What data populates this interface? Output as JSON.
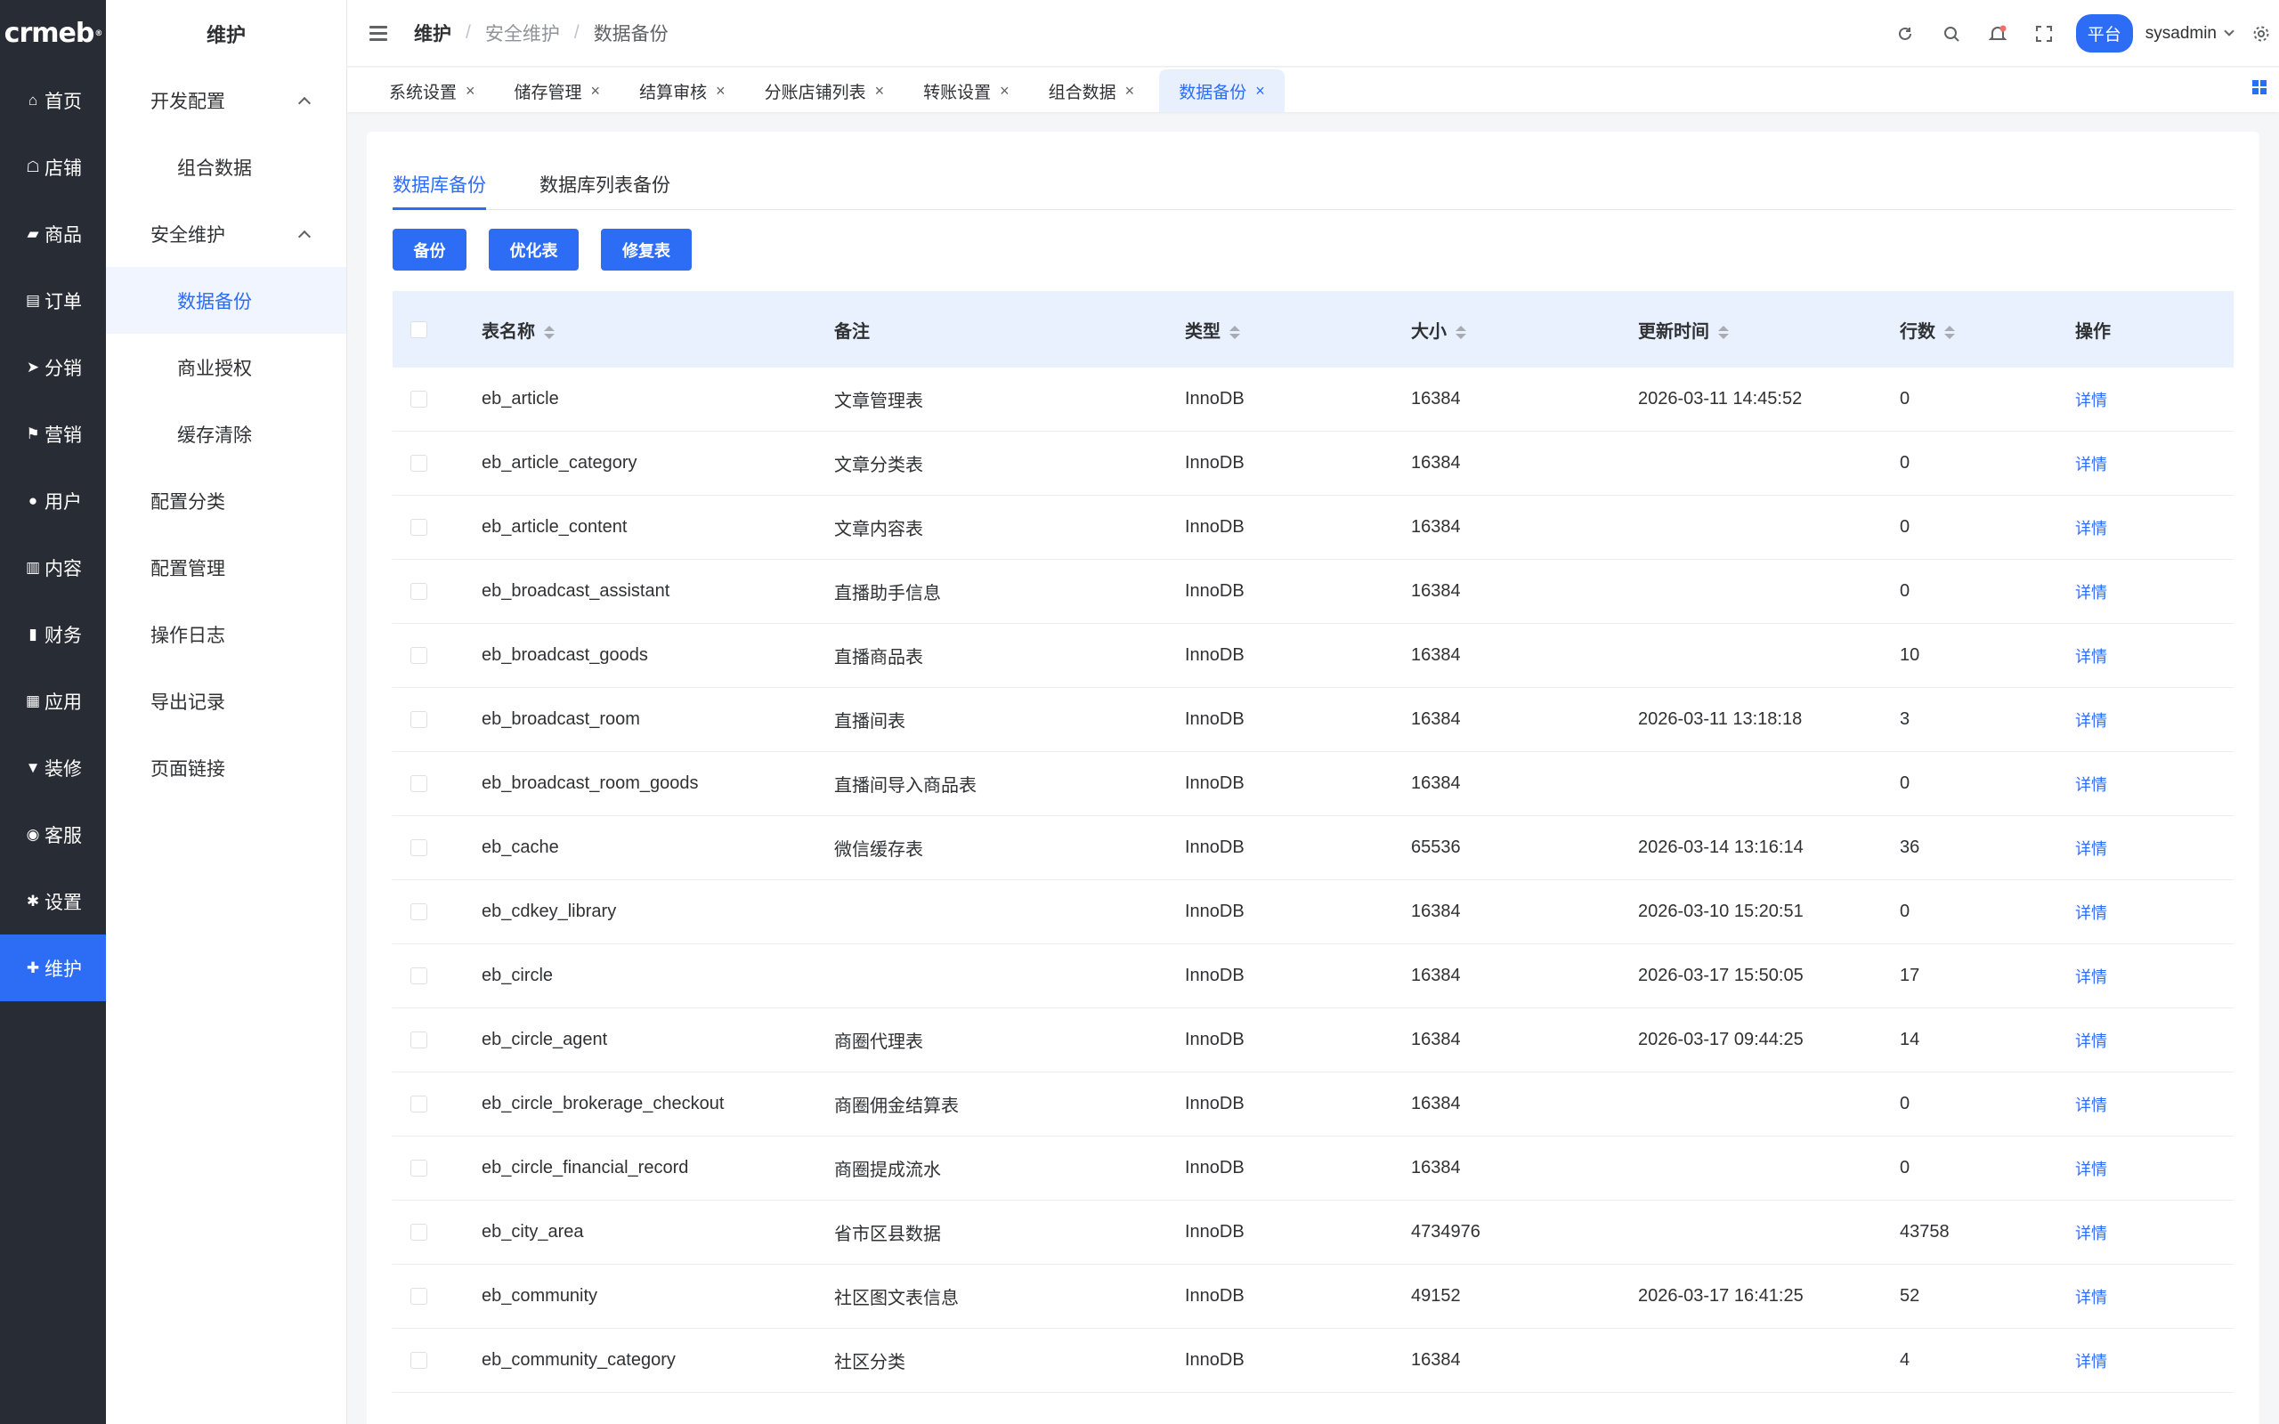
{
  "sidebar": {
    "logo": "crmeb",
    "items": [
      {
        "label": "首页",
        "icon": "home-icon"
      },
      {
        "label": "店铺",
        "icon": "store-icon"
      },
      {
        "label": "商品",
        "icon": "bag-icon"
      },
      {
        "label": "订单",
        "icon": "clipboard-icon"
      },
      {
        "label": "分销",
        "icon": "send-icon"
      },
      {
        "label": "营销",
        "icon": "flag-icon"
      },
      {
        "label": "用户",
        "icon": "user-icon"
      },
      {
        "label": "内容",
        "icon": "book-icon"
      },
      {
        "label": "财务",
        "icon": "bar-chart-icon"
      },
      {
        "label": "应用",
        "icon": "grid-icon"
      },
      {
        "label": "装修",
        "icon": "paint-icon"
      },
      {
        "label": "客服",
        "icon": "headset-icon"
      },
      {
        "label": "设置",
        "icon": "gear-icon"
      },
      {
        "label": "维护",
        "icon": "maintain-icon"
      }
    ]
  },
  "submenu": {
    "title": "维护",
    "group_dev": "开发配置",
    "item_combo": "组合数据",
    "group_security": "安全维护",
    "item_backup": "数据备份",
    "item_license": "商业授权",
    "item_cache": "缓存清除",
    "config_category": "配置分类",
    "config_manage": "配置管理",
    "op_log": "操作日志",
    "export_log": "导出记录",
    "page_link": "页面链接"
  },
  "header": {
    "crumb1": "维护",
    "crumb2": "安全维护",
    "crumb3": "数据备份",
    "platform": "平台",
    "username": "sysadmin"
  },
  "tabs": [
    {
      "label": "系统设置"
    },
    {
      "label": "储存管理"
    },
    {
      "label": "结算审核"
    },
    {
      "label": "分账店铺列表"
    },
    {
      "label": "转账设置"
    },
    {
      "label": "组合数据"
    },
    {
      "label": "数据备份"
    }
  ],
  "inner_tabs": {
    "db_backup": "数据库备份",
    "db_list_backup": "数据库列表备份"
  },
  "buttons": {
    "backup": "备份",
    "optimize": "优化表",
    "repair": "修复表"
  },
  "table": {
    "columns": {
      "name": "表名称",
      "remark": "备注",
      "type": "类型",
      "size": "大小",
      "updated": "更新时间",
      "rows": "行数",
      "action": "操作"
    },
    "action_label": "详情",
    "rows": [
      {
        "name": "eb_article",
        "remark": "文章管理表",
        "type": "InnoDB",
        "size": "16384",
        "updated": "2026-03-11 14:45:52",
        "rows": "0"
      },
      {
        "name": "eb_article_category",
        "remark": "文章分类表",
        "type": "InnoDB",
        "size": "16384",
        "updated": "",
        "rows": "0"
      },
      {
        "name": "eb_article_content",
        "remark": "文章内容表",
        "type": "InnoDB",
        "size": "16384",
        "updated": "",
        "rows": "0"
      },
      {
        "name": "eb_broadcast_assistant",
        "remark": "直播助手信息",
        "type": "InnoDB",
        "size": "16384",
        "updated": "",
        "rows": "0"
      },
      {
        "name": "eb_broadcast_goods",
        "remark": "直播商品表",
        "type": "InnoDB",
        "size": "16384",
        "updated": "",
        "rows": "10"
      },
      {
        "name": "eb_broadcast_room",
        "remark": "直播间表",
        "type": "InnoDB",
        "size": "16384",
        "updated": "2026-03-11 13:18:18",
        "rows": "3"
      },
      {
        "name": "eb_broadcast_room_goods",
        "remark": "直播间导入商品表",
        "type": "InnoDB",
        "size": "16384",
        "updated": "",
        "rows": "0"
      },
      {
        "name": "eb_cache",
        "remark": "微信缓存表",
        "type": "InnoDB",
        "size": "65536",
        "updated": "2026-03-14 13:16:14",
        "rows": "36"
      },
      {
        "name": "eb_cdkey_library",
        "remark": "",
        "type": "InnoDB",
        "size": "16384",
        "updated": "2026-03-10 15:20:51",
        "rows": "0"
      },
      {
        "name": "eb_circle",
        "remark": "",
        "type": "InnoDB",
        "size": "16384",
        "updated": "2026-03-17 15:50:05",
        "rows": "17"
      },
      {
        "name": "eb_circle_agent",
        "remark": "商圈代理表",
        "type": "InnoDB",
        "size": "16384",
        "updated": "2026-03-17 09:44:25",
        "rows": "14"
      },
      {
        "name": "eb_circle_brokerage_checkout",
        "remark": "商圈佣金结算表",
        "type": "InnoDB",
        "size": "16384",
        "updated": "",
        "rows": "0"
      },
      {
        "name": "eb_circle_financial_record",
        "remark": "商圈提成流水",
        "type": "InnoDB",
        "size": "16384",
        "updated": "",
        "rows": "0"
      },
      {
        "name": "eb_city_area",
        "remark": "省市区县数据",
        "type": "InnoDB",
        "size": "4734976",
        "updated": "",
        "rows": "43758"
      },
      {
        "name": "eb_community",
        "remark": "社区图文表信息",
        "type": "InnoDB",
        "size": "49152",
        "updated": "2026-03-17 16:41:25",
        "rows": "52"
      },
      {
        "name": "eb_community_category",
        "remark": "社区分类",
        "type": "InnoDB",
        "size": "16384",
        "updated": "",
        "rows": "4"
      }
    ]
  },
  "colors": {
    "accent": "#2d6df5",
    "sidebar_bg": "#282c34",
    "header_row_bg": "#e9f1ff"
  }
}
